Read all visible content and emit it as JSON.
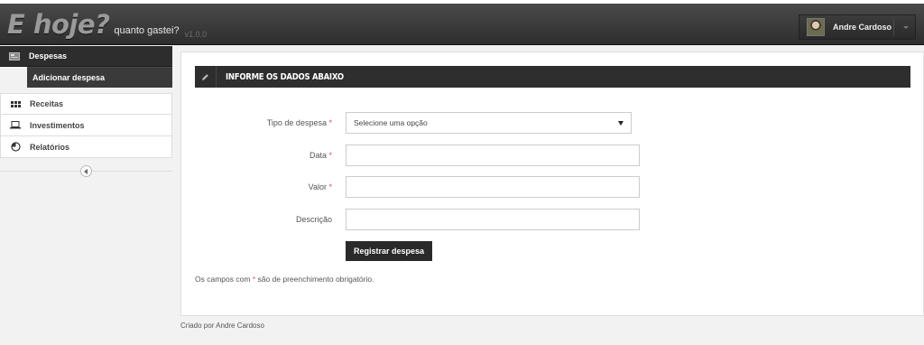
{
  "app": {
    "brand": "E hoje?",
    "tagline": "quanto gastei?",
    "version": "v1.0.0"
  },
  "user": {
    "name": "Andre Cardoso"
  },
  "sidebar": {
    "items": [
      {
        "label": "Despesas",
        "icon": "wallet-icon",
        "active": true
      },
      {
        "label": "Adicionar despesa",
        "sub": true
      },
      {
        "label": "Receitas",
        "icon": "grid-icon"
      },
      {
        "label": "Investimentos",
        "icon": "laptop-icon"
      },
      {
        "label": "Relatórios",
        "icon": "pie-chart-icon"
      }
    ]
  },
  "form": {
    "title": "INFORME OS DADOS ABAIXO",
    "fields": {
      "tipo": {
        "label": "Tipo de despesa",
        "selected": "Selecione uma opção"
      },
      "data": {
        "label": "Data",
        "value": ""
      },
      "valor": {
        "label": "Valor",
        "value": ""
      },
      "descricao": {
        "label": "Descrição",
        "value": ""
      }
    },
    "required_mark": "*",
    "submit_label": "Registrar despesa",
    "note_before": "Os campos com",
    "note_after": "são de preenchimento obrigatório."
  },
  "footer": {
    "text": "Criado por Andre Cardoso"
  },
  "colors": {
    "navbar": "#333333",
    "accent_dark": "#2e2e2e",
    "required": "#d9534f"
  }
}
